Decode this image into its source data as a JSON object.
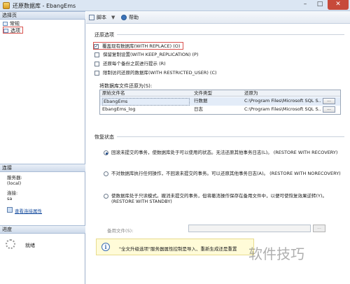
{
  "window": {
    "title": "还原数据库 - EbangEms",
    "min_glyph": "–",
    "max_glyph": "□",
    "close_glyph": "✕"
  },
  "left_panel": {
    "pages_header": "选择页",
    "pages": [
      {
        "label": "常规",
        "selected": false
      },
      {
        "label": "选项",
        "selected": true
      }
    ],
    "connection_header": "连接",
    "server_label": "服务器:",
    "server_value": "(local)",
    "connection_label": "连接:",
    "connection_value": "sa",
    "view_connection_link": "查看连接属性",
    "progress_header": "进度",
    "progress_status": "就绪"
  },
  "toolbar": {
    "script_label": "脚本",
    "script_dropdown": "▼",
    "help_label": "帮助"
  },
  "restore_options": {
    "section_title": "还原选项",
    "checkboxes": [
      {
        "label": "覆盖现有数据库(WITH REPLACE) (O)",
        "checked": true
      },
      {
        "label": "保留复制设置(WITH KEEP_REPLICATION) (P)",
        "checked": false
      },
      {
        "label": "还原每个备份之前进行提示 (R)",
        "checked": false
      },
      {
        "label": "限制访问还原的数据库(WITH RESTRICTED_USER) (C)",
        "checked": false
      }
    ],
    "restore_files_label": "将数据库文件还原为(S):",
    "columns": [
      "原始文件名",
      "文件类型",
      "还原为"
    ],
    "files": [
      {
        "original": "EbangEms",
        "type": "行数据",
        "restore_as": "C:\\Program Files\\Microsoft SQL S..."
      },
      {
        "original": "EbangEms_log",
        "type": "日志",
        "restore_as": "C:\\Program Files\\Microsoft SQL S..."
      }
    ],
    "browse_button": "..."
  },
  "recovery_state": {
    "section_title": "恢复状态",
    "options": [
      {
        "label": "回滚未提交的事务，使数据库处于可以使用的状态。无法还原其他事务日志(L)。 (RESTORE WITH RECOVERY)",
        "selected": true
      },
      {
        "label": "不对数据库执行任何操作，不回滚未提交的事务。可以还原其他事务日志(A)。 (RESTORE WITH NORECOVERY)",
        "selected": false
      },
      {
        "label_line1": "使数据库处于只读模式。撤消未提交的事务，但将撤消操作保存在备用文件中，以便可使恢复效果逆转(Y)。",
        "label_line2": "(RESTORE WITH STANDBY)",
        "selected": false
      }
    ],
    "standby_file_label": "备用文件(S):",
    "standby_file_value": "",
    "standby_browse": "..."
  },
  "info_bar": {
    "icon": "info-icon",
    "text": "\"全文升级选项\"服务器属性控制是导入、重新生成还是重置"
  },
  "watermark": "软件技巧"
}
